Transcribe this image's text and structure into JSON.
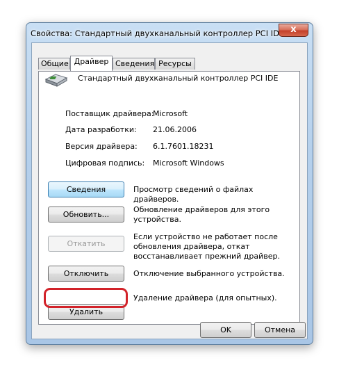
{
  "window": {
    "title": "Свойства: Стандартный двухканальный контроллер PCI IDE",
    "close_glyph": "x"
  },
  "tabs": [
    {
      "label": "Общие",
      "active": false
    },
    {
      "label": "Драйвер",
      "active": true
    },
    {
      "label": "Сведения",
      "active": false
    },
    {
      "label": "Ресурсы",
      "active": false
    }
  ],
  "device": {
    "icon": "ide-controller-icon",
    "name": "Стандартный двухканальный контроллер PCI IDE"
  },
  "properties": [
    {
      "label": "Поставщик драйвера:",
      "value": "Microsoft"
    },
    {
      "label": "Дата разработки:",
      "value": "21.06.2006"
    },
    {
      "label": "Версия драйвера:",
      "value": "6.1.7601.18231"
    },
    {
      "label": "Цифровая подпись:",
      "value": "Microsoft Windows"
    }
  ],
  "actions": [
    {
      "label": "Сведения",
      "description": "Просмотр сведений о файлах драйверов.",
      "enabled": true
    },
    {
      "label": "Обновить...",
      "description": "Обновление драйверов для этого устройства.",
      "enabled": true
    },
    {
      "label": "Откатить",
      "description": "Если устройство не работает после обновления драйвера, откат восстанавливает прежний драйвер.",
      "enabled": false
    },
    {
      "label": "Отключить",
      "description": "Отключение выбранного устройства.",
      "enabled": true
    },
    {
      "label": "Удалить",
      "description": "Удаление драйвера (для опытных).",
      "enabled": true
    }
  ],
  "footer": {
    "ok_label": "OK",
    "cancel_label": "Отмена"
  },
  "colors": {
    "highlight_ring": "#d2232a",
    "focused_button": "#bee6fd"
  }
}
